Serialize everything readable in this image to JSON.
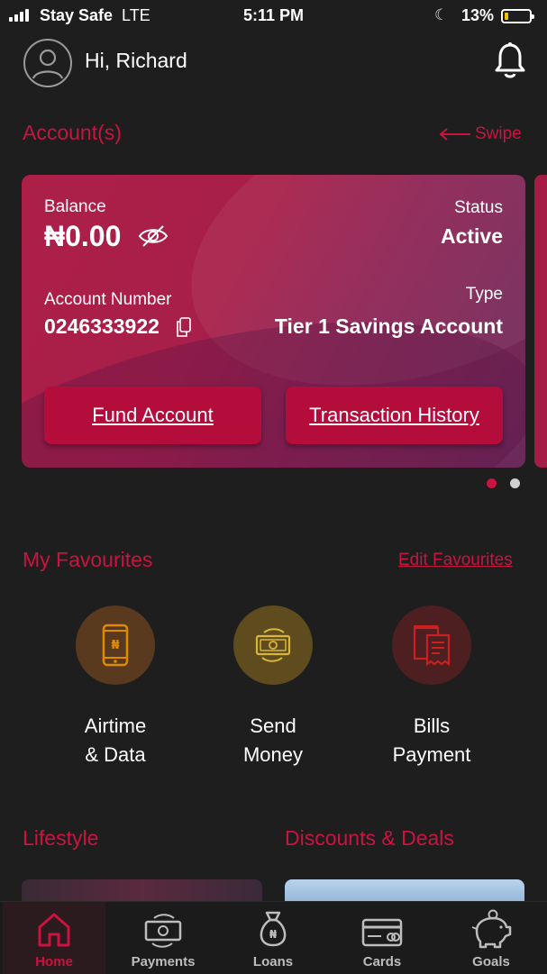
{
  "status_bar": {
    "carrier": "Stay Safe",
    "network": "LTE",
    "time": "5:11 PM",
    "battery": "13%",
    "battery_level": 0.13
  },
  "header": {
    "greeting": "Hi, Richard",
    "avatar_icon": "user-icon",
    "notification_icon": "bell-icon"
  },
  "accounts": {
    "title": "Account(s)",
    "swipe_label": "Swipe",
    "card": {
      "balance_label": "Balance",
      "balance": "₦0.00",
      "status_label": "Status",
      "status": "Active",
      "account_number_label": "Account Number",
      "account_number": "0246333922",
      "type_label": "Type",
      "type": "Tier 1 Savings Account",
      "fund_button": "Fund Account",
      "history_button": "Transaction History"
    },
    "page_indicator": {
      "count": 2,
      "active": 0
    }
  },
  "favourites": {
    "title": "My Favourites",
    "edit_label": "Edit Favourites",
    "items": [
      {
        "line1": "Airtime",
        "line2": "& Data",
        "icon": "phone-naira-icon",
        "color": "#e08a00"
      },
      {
        "line1": "Send",
        "line2": "Money",
        "icon": "money-transfer-icon",
        "color": "#d9b53a"
      },
      {
        "line1": "Bills",
        "line2": "Payment",
        "icon": "bill-receipt-icon",
        "color": "#cc1f1f"
      }
    ]
  },
  "sections": {
    "lifestyle": "Lifestyle",
    "discounts": "Discounts & Deals"
  },
  "bottom_nav": [
    {
      "label": "Home",
      "icon": "home-icon",
      "active": true
    },
    {
      "label": "Payments",
      "icon": "payments-icon",
      "active": false
    },
    {
      "label": "Loans",
      "icon": "money-bag-icon",
      "active": false
    },
    {
      "label": "Cards",
      "icon": "card-icon",
      "active": false
    },
    {
      "label": "Goals",
      "icon": "piggy-bank-icon",
      "active": false
    }
  ],
  "colors": {
    "accent": "#c8143f",
    "background": "#1e1e1f",
    "card_gradient_start": "#ad1f47",
    "card_gradient_end": "#6a2a5a",
    "button": "#b40c3b"
  }
}
